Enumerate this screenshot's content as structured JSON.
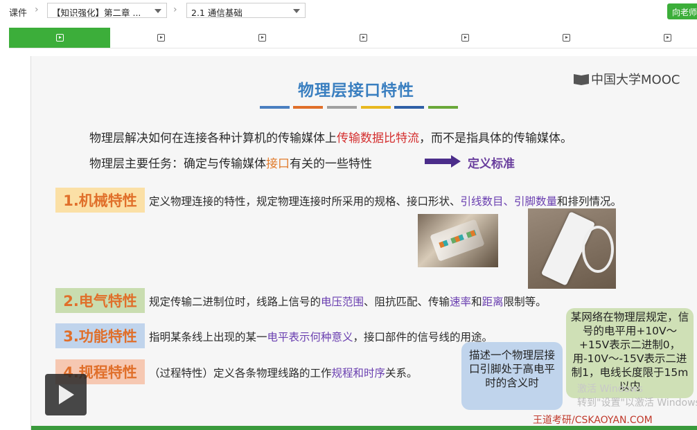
{
  "topbar": {
    "courseware_label": "课件",
    "chapter_select": "【知识强化】第二章 ...",
    "lesson_select": "2.1 通信基础",
    "teacher_button": "向老师"
  },
  "tabs": {
    "count": 7,
    "active_index": 0
  },
  "slide": {
    "title": "物理层接口特性",
    "logo_text": "中国大学MOOC",
    "color_bars": [
      "#4a7fc0",
      "#e06f2a",
      "#a0a0a0",
      "#e8b820",
      "#2f5fa6",
      "#6aa83a"
    ],
    "line1": {
      "prefix": "物理层解决如何在连接各种计算机的传输媒体上",
      "highlight": "传输数据比特流",
      "suffix": "，而不是指具体的传输媒体。"
    },
    "line2": {
      "prefix": "物理层主要任务：确定与传输媒体",
      "highlight": "接口",
      "suffix": "有关的一些特性",
      "target": "定义标准"
    },
    "items": [
      {
        "badge": "1.机械特性",
        "badge_color": "#fbe0a6",
        "parts": [
          {
            "text": "定义物理连接的特性，规定物理连接时所采用的规格、接口形状、",
            "hl": false
          },
          {
            "text": "引线数目、引脚数量",
            "hl": true
          },
          {
            "text": "和排列情况。",
            "hl": false
          }
        ]
      },
      {
        "badge": "2.电气特性",
        "badge_color": "#c9ddb0",
        "parts": [
          {
            "text": "规定传输二进制位时，线路上信号的",
            "hl": false
          },
          {
            "text": "电压范围",
            "hl": true
          },
          {
            "text": "、阻抗匹配、传输",
            "hl": false
          },
          {
            "text": "速率",
            "hl": true
          },
          {
            "text": "和",
            "hl": false
          },
          {
            "text": "距离",
            "hl": true
          },
          {
            "text": "限制等。",
            "hl": false
          }
        ]
      },
      {
        "badge": "3.功能特性",
        "badge_color": "#c0d4ec",
        "parts": [
          {
            "text": "指明某条线上出现的某一",
            "hl": false
          },
          {
            "text": "电平表示何种意义",
            "hl": true
          },
          {
            "text": "，接口部件的信号线的用途。",
            "hl": false
          }
        ]
      },
      {
        "badge": "4.规程特性",
        "badge_color": "#f6c8b2",
        "parts": [
          {
            "text": "（过程特性）定义各条物理线路的工作",
            "hl": false
          },
          {
            "text": "规程和时序",
            "hl": true
          },
          {
            "text": "关系。",
            "hl": false
          }
        ]
      }
    ],
    "callout_blue": "描述一个物理层接口引脚处于高电平时的含义时",
    "callout_green": "某网络在物理层规定，信号的电平用+10V～+15V表示二进制0，用-10V～-15V表示二进制1，电线长度限于15m以内",
    "watermark_line1": "激活 Windows",
    "watermark_line2": "转到\"设置\"以激活 Windows。",
    "credit": "王道考研/CSKAOYAN.COM"
  }
}
